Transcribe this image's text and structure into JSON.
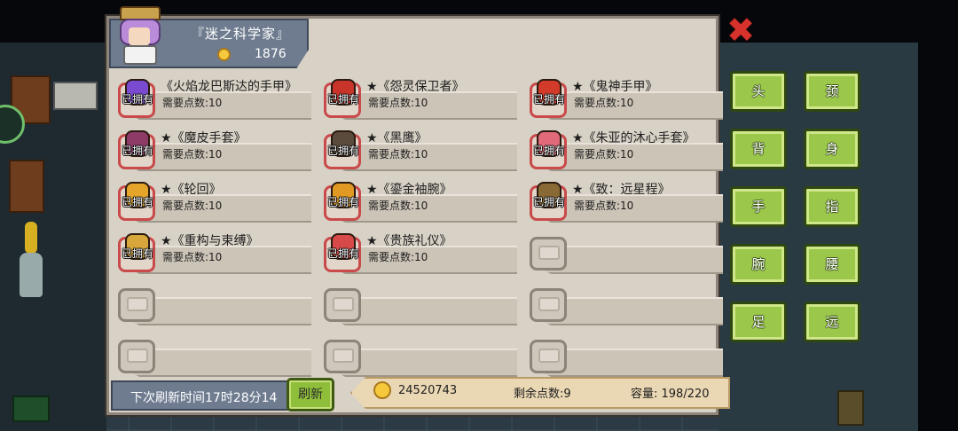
{
  "header": {
    "title": "『迷之科学家』",
    "coins": "1876"
  },
  "items": [
    {
      "owned": true,
      "owned_label": "已拥有",
      "name": "《火焰龙巴斯达的手甲》",
      "points": "需要点数:10",
      "icon": "flame-dragon-gauntlet-icon",
      "color": "#7a4ad0"
    },
    {
      "owned": true,
      "owned_label": "已拥有",
      "name": "★《怨灵保卫者》",
      "points": "需要点数:10",
      "icon": "vengeful-guardian-icon",
      "color": "#c8342a"
    },
    {
      "owned": true,
      "owned_label": "已拥有",
      "name": "★《鬼神手甲》",
      "points": "需要点数:10",
      "icon": "demon-gauntlet-icon",
      "color": "#d23a2a"
    },
    {
      "owned": true,
      "owned_label": "已拥有",
      "name": "★《魔皮手套》",
      "points": "需要点数:10",
      "icon": "demon-skin-glove-icon",
      "color": "#8e3b68"
    },
    {
      "owned": true,
      "owned_label": "已拥有",
      "name": "★《黑鹰》",
      "points": "需要点数:10",
      "icon": "black-hawk-icon",
      "color": "#5a4b3c"
    },
    {
      "owned": true,
      "owned_label": "已拥有",
      "name": "★《朱亚的沐心手套》",
      "points": "需要点数:10",
      "icon": "zhuya-glove-icon",
      "color": "#e06a7a"
    },
    {
      "owned": true,
      "owned_label": "已拥有",
      "name": "★《轮回》",
      "points": "需要点数:10",
      "icon": "reincarnation-icon",
      "color": "#e5a52a"
    },
    {
      "owned": true,
      "owned_label": "已拥有",
      "name": "★《鎏金袖腕》",
      "points": "需要点数:10",
      "icon": "gilded-cuff-icon",
      "color": "#e09a24"
    },
    {
      "owned": true,
      "owned_label": "已拥有",
      "name": "★《致：远星程》",
      "points": "需要点数:10",
      "icon": "distant-star-icon",
      "color": "#8a6a34"
    },
    {
      "owned": true,
      "owned_label": "已拥有",
      "name": "★《重构与束缚》",
      "points": "需要点数:10",
      "icon": "reconstruct-bind-icon",
      "color": "#d8a63a"
    },
    {
      "owned": true,
      "owned_label": "已拥有",
      "name": "★《贵族礼仪》",
      "points": "需要点数:10",
      "icon": "noble-etiquette-icon",
      "color": "#d84a4a"
    },
    {
      "owned": false
    },
    {
      "owned": false
    },
    {
      "owned": false
    },
    {
      "owned": false
    },
    {
      "owned": false
    },
    {
      "owned": false
    },
    {
      "owned": false
    }
  ],
  "footer": {
    "refresh_time": "下次刷新时间17时28分14",
    "refresh_button": "刷新",
    "gold": "24520743",
    "remaining_points": "剩余点数:9",
    "capacity": "容量: 198/220"
  },
  "close_icon": "close-x-icon",
  "categories": [
    {
      "key": "head",
      "label": "头"
    },
    {
      "key": "neck",
      "label": "颈"
    },
    {
      "key": "back",
      "label": "背"
    },
    {
      "key": "body",
      "label": "身"
    },
    {
      "key": "hand",
      "label": "手"
    },
    {
      "key": "finger",
      "label": "指"
    },
    {
      "key": "wrist",
      "label": "腕"
    },
    {
      "key": "waist",
      "label": "腰"
    },
    {
      "key": "foot",
      "label": "足"
    },
    {
      "key": "ranged",
      "label": "远"
    }
  ]
}
